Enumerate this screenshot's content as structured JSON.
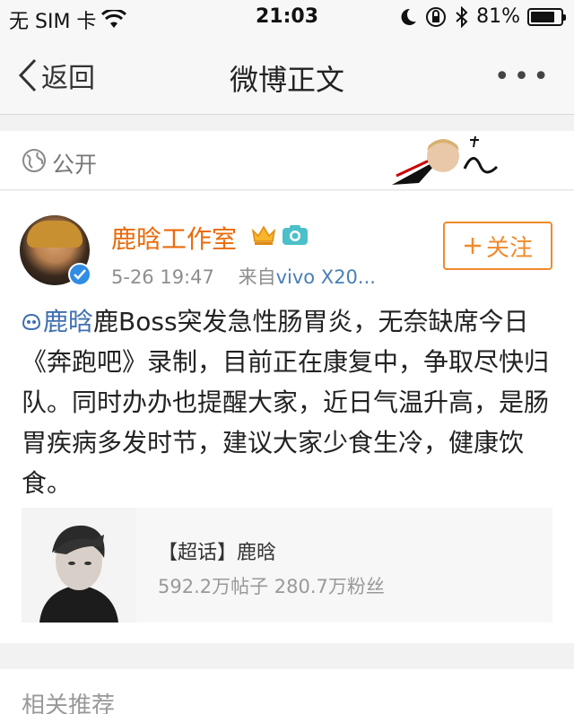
{
  "status_bar": {
    "carrier": "无 SIM 卡",
    "time": "21:03",
    "battery_percent": "81%",
    "battery_level": 0.81,
    "icons": [
      "wifi-icon",
      "moon-icon",
      "orientation-lock-icon",
      "bluetooth-icon",
      "battery-icon"
    ]
  },
  "nav": {
    "back_label": "返回",
    "title": "微博正文",
    "more_label": "•••"
  },
  "visibility": {
    "label": "公开"
  },
  "post": {
    "author": "鹿晗工作室",
    "timestamp": "5-26 19:47",
    "source_prefix": "来自",
    "source": "vivo X20...",
    "follow_label": "关注",
    "topic_link": "鹿晗",
    "body": "鹿Boss突发急性肠胃炎，无奈缺席今日《奔跑吧》录制，目前正在康复中，争取尽快归队。同时办办也提醒大家，近日气温升高，是肠胃疾病多发时节，建议大家少食生冷，健康饮食。",
    "card": {
      "title": "【超话】鹿晗",
      "stats": "592.2万帖子  280.7万粉丝"
    }
  },
  "related": {
    "title": "相关推荐"
  },
  "colors": {
    "accent_orange": "#f08a2c",
    "author_orange": "#e86b0c",
    "link_blue": "#3e6fb0",
    "verified_blue": "#2f8de4"
  }
}
